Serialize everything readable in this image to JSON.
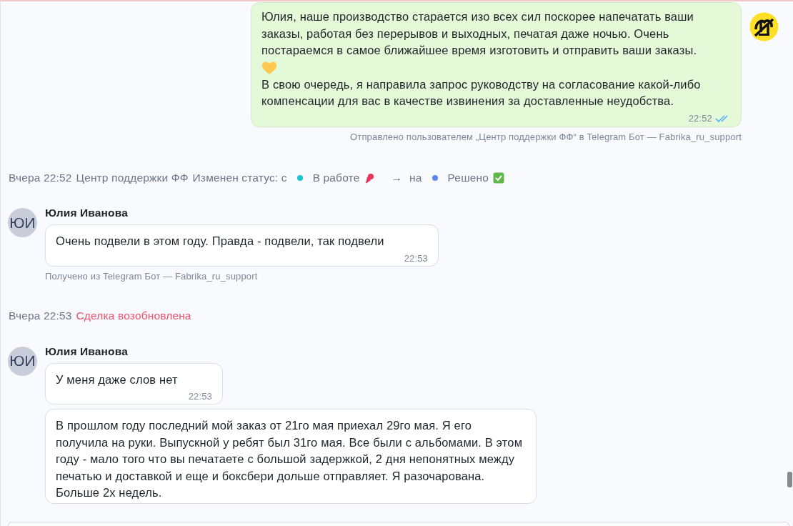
{
  "feed": [
    {
      "kind": "outgoing",
      "paragraphs": [
        "Юлия, наше производство старается изо всех сил поскорее напечатать ваши заказы, работая без перерывов и выходных, печатая даже ночью. Очень постараемся в самое ближайшее время изготовить и отправить ваши заказы.",
        "В свою очередь, я направила запрос руководству на согласование какой-либо компенсации для вас в качестве извинения за доставленные неудобства."
      ],
      "time": "22:52",
      "read": true,
      "caption": "Отправлено пользователем „Центр поддержки ФФ“ в Telegram Бот — Fabrika_ru_support"
    },
    {
      "kind": "status",
      "time": "Вчера 22:52",
      "author": "Центр поддержки ФФ",
      "label": "Изменен статус: с",
      "from": {
        "name": "В работе",
        "color": "#19c3cf"
      },
      "arrow": "→",
      "to_label": "на",
      "to": {
        "name": "Решено",
        "color": "#5b86f0"
      }
    },
    {
      "kind": "incoming",
      "initials": "ЮИ",
      "author": "Юлия Иванова",
      "bubbles": [
        {
          "text": "Очень подвели в этом году. Правда - подвели, так подвели",
          "time": "22:53"
        }
      ],
      "caption": "Получено из Telegram Бот — Fabrika_ru_support"
    },
    {
      "kind": "event",
      "time": "Вчера 22:53",
      "text": "Сделка возобновлена"
    },
    {
      "kind": "incoming",
      "initials": "ЮИ",
      "author": "Юлия Иванова",
      "bubbles": [
        {
          "text": "У меня даже слов нет",
          "time": "22:53"
        },
        {
          "text": "В прошлом году последний мой заказ от 21го мая приехал 29го мая. Я его получила на руки. Выпускной у ребят был 31го мая. Все были с альбомами. В этом году - мало того что вы печатаете с большой задержкой, 2 дня непонятных между печатью и доставкой и  еще и боксбери дольше отправляет.  Я разочарована. Больше 2х недель."
        }
      ]
    }
  ]
}
